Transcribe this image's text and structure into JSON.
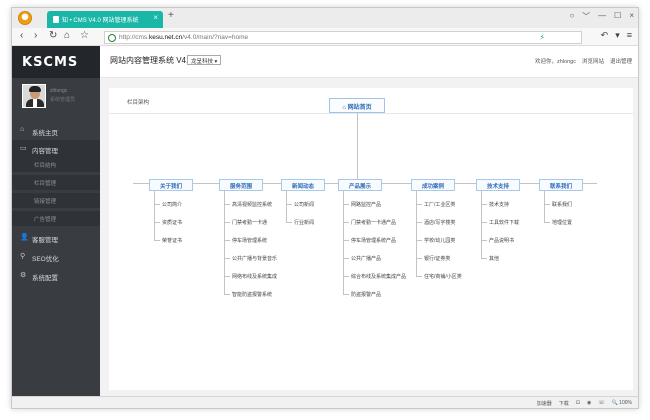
{
  "browser": {
    "tab_title": "知 • CMS V4.0 网站管理系统",
    "tab_close": "×",
    "new_tab": "+",
    "window_controls": [
      "○",
      "﹀",
      "—",
      "☐",
      "×"
    ],
    "url_prefix": "http://cms.",
    "url_host": "kesu.net.cn",
    "url_path": "/v4.0/main/?nav=home",
    "nav": {
      "back": "‹",
      "forward": "›",
      "reload": "↻",
      "home": "⌂",
      "star": "☆"
    },
    "addr_right": [
      "↶",
      "▾",
      "≡"
    ]
  },
  "brand": "KSCMS",
  "profile": {
    "name": "zhlongc",
    "role": "系统管理员"
  },
  "sidebar": {
    "items": [
      {
        "icon": "⌂",
        "label": "系统主页"
      },
      {
        "icon": "▭",
        "label": "内容管理"
      },
      {
        "icon": "👤",
        "label": "客服管理"
      },
      {
        "icon": "⚲",
        "label": "SEO优化"
      },
      {
        "icon": "⚙",
        "label": "系统配置"
      }
    ],
    "sub_items": [
      "栏目结构",
      "栏目管理",
      "链接管理",
      "广告管理"
    ]
  },
  "header": {
    "title": "网站内容管理系统 V4.0",
    "org_select": "龙呈科技",
    "welcome": "欢迎你，zhlongc",
    "browse_site": "浏览网站",
    "logout": "退出管理"
  },
  "breadcrumb": "栏目架构",
  "tree": {
    "root": "网站首页",
    "categories": [
      {
        "label": "关于我们",
        "children": [
          "公司简介",
          "资质证书",
          "荣誉证书"
        ]
      },
      {
        "label": "服务范围",
        "children": [
          "高清视频监控系统",
          "门禁考勤一卡通",
          "停车场管理系统",
          "公共广播与背景音乐",
          "网络布线及系统集成",
          "智能防盗报警系统"
        ]
      },
      {
        "label": "新闻动态",
        "children": [
          "公司新闻",
          "行业新闻"
        ]
      },
      {
        "label": "产品展示",
        "children": [
          "网路监控产品",
          "门禁考勤一卡通产品",
          "停车场管理系统产品",
          "公共广播产品",
          "综合布线及系统集成产品",
          "防盗报警产品"
        ]
      },
      {
        "label": "成功案例",
        "children": [
          "工厂/工业区类",
          "酒店/写字楼类",
          "学校/幼儿园类",
          "银行/证券类",
          "住宅/商铺/小区类"
        ]
      },
      {
        "label": "技术支持",
        "children": [
          "技术支持",
          "工具软件下载",
          "产品说明书",
          "其他"
        ]
      },
      {
        "label": "联系我们",
        "children": [
          "联系我们",
          "地理位置"
        ]
      }
    ]
  },
  "status": [
    "加速器",
    "下载",
    "⊡",
    "◉",
    "☏",
    "🔍 100%"
  ],
  "colors": {
    "sidebar": "#393d42",
    "brand_bg": "#23262b",
    "tab": "#1ab7a8",
    "link": "#2d6cb5"
  }
}
